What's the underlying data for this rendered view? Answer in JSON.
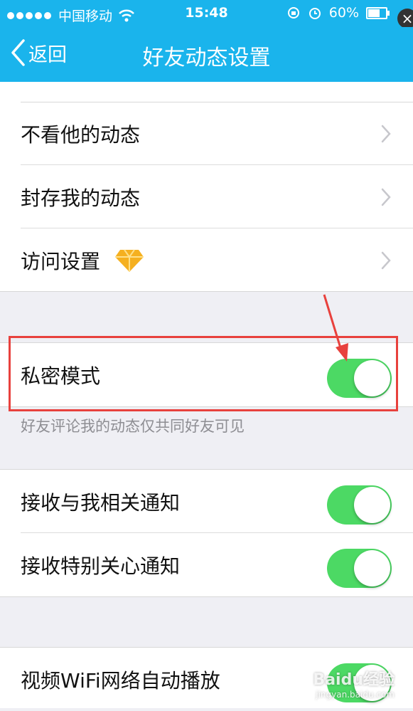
{
  "status_bar": {
    "carrier": "中国移动",
    "time": "15:48",
    "battery": "60%",
    "battery_level": 0.6
  },
  "nav": {
    "back_label": "返回",
    "title": "好友动态设置"
  },
  "group1": {
    "items": [
      {
        "label": "不看他的动态"
      },
      {
        "label": "封存我的动态"
      },
      {
        "label": "访问设置"
      }
    ]
  },
  "privacy": {
    "label": "私密模式",
    "on": true,
    "hint": "好友评论我的动态仅共同好友可见"
  },
  "notifications": {
    "items": [
      {
        "label": "接收与我相关通知",
        "on": true
      },
      {
        "label": "接收特别关心通知",
        "on": true
      }
    ]
  },
  "video": {
    "label": "视频WiFi网络自动播放",
    "on": true
  },
  "watermark": {
    "brand": "Baidu经验",
    "url": "jingyan.baidu.com"
  },
  "colors": {
    "accent": "#1ab4ec",
    "toggle_on": "#4cd964",
    "annotation": "#e8413d"
  }
}
